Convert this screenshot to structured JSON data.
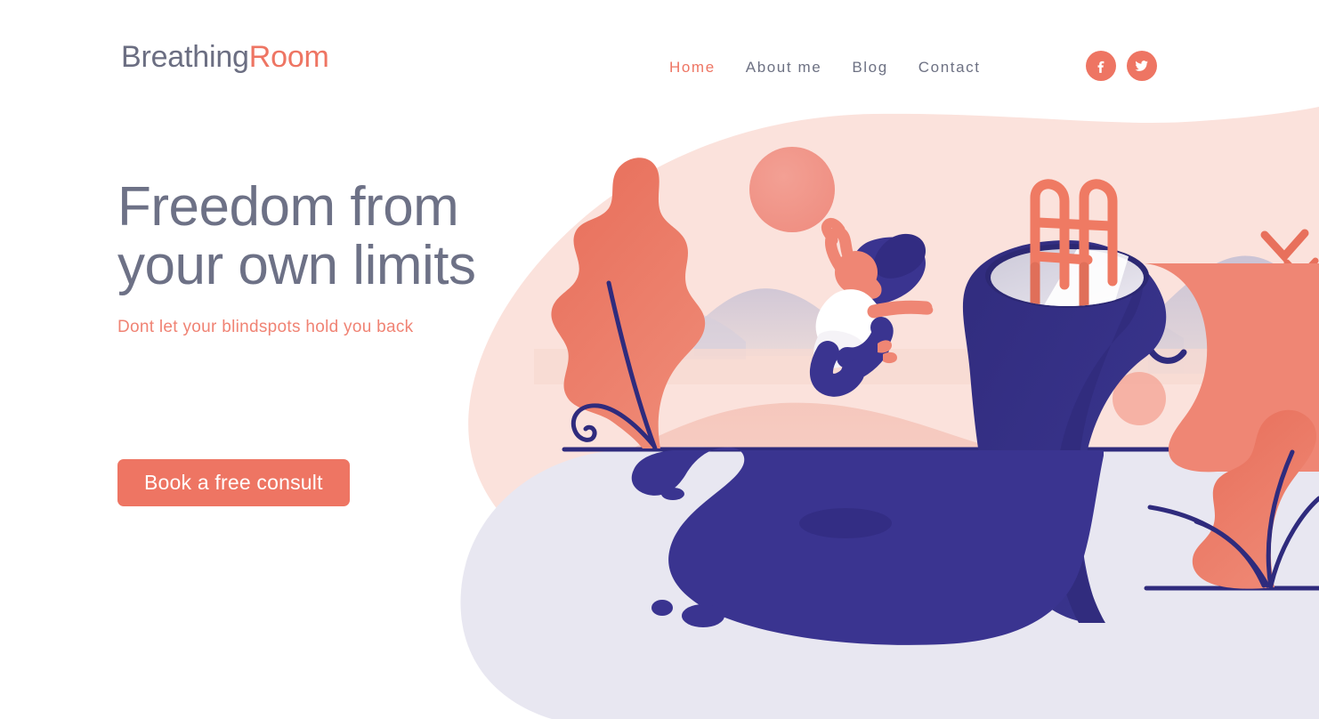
{
  "header": {
    "logo": {
      "primary": "Breathing",
      "accent": "Room"
    },
    "nav": [
      {
        "label": "Home",
        "active": true
      },
      {
        "label": "About me",
        "active": false
      },
      {
        "label": "Blog",
        "active": false
      },
      {
        "label": "Contact",
        "active": false
      }
    ],
    "socials": [
      {
        "name": "facebook",
        "glyph": "f"
      },
      {
        "name": "twitter",
        "glyph": "bird"
      }
    ]
  },
  "hero": {
    "headline": "Freedom from\nyour own limits",
    "subheadline": "Dont let your blindspots hold you back",
    "cta_label": "Book a free consult"
  },
  "illustration": {
    "alt": "Woman leaping into a pool inside an open head, beside coral leaves, navy spill, pink sky with sun and birds",
    "elements": [
      "pink-sky-blob",
      "sun",
      "mountains",
      "birds",
      "coral-hills",
      "left-leaf-plant",
      "jumping-woman",
      "head-with-pool",
      "pool-ladder",
      "navy-spill",
      "right-leaf-plant",
      "lavender-ground"
    ]
  },
  "colors": {
    "coral": "#ee7563",
    "coral_light": "#f0948a",
    "navy": "#363285",
    "slate": "#6d7186",
    "pink_sky": "#fbe2dc",
    "pink_hill": "#f6cec5",
    "lavender": "#e8e7f1",
    "mountain": "#c9c5d8",
    "white": "#ffffff"
  }
}
